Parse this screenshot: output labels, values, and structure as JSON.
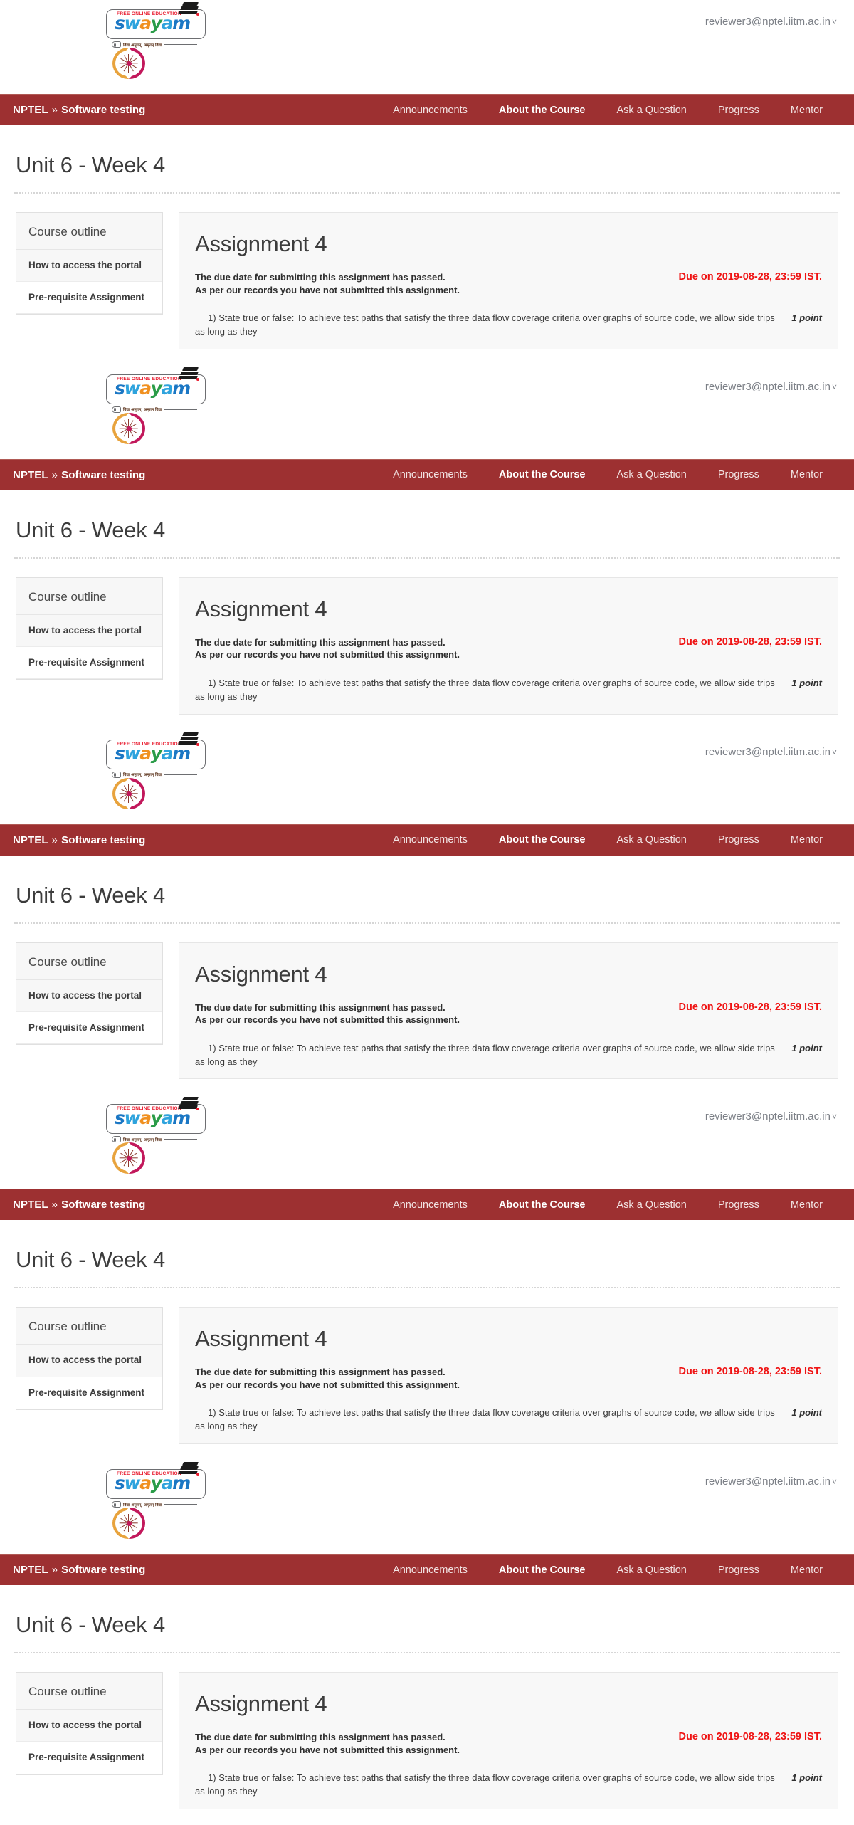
{
  "header": {
    "logo_swayam": {
      "tagline_top": "FREE ONLINE EDUCATION",
      "wordmark": "swayam",
      "tagline_bottom": "विद्या अमृतम्, अमृतम् विद्या"
    },
    "logo_iitm_name": "iitm-logo",
    "user_email": "reviewer3@nptel.iitm.ac.in",
    "user_caret": "˅"
  },
  "navbar": {
    "brand": "NPTEL",
    "separator": "»",
    "course": "Software testing",
    "items": [
      {
        "label": "Announcements",
        "active": false
      },
      {
        "label": "About the Course",
        "active": true
      },
      {
        "label": "Ask a Question",
        "active": false
      },
      {
        "label": "Progress",
        "active": false
      },
      {
        "label": "Mentor",
        "active": false
      }
    ]
  },
  "page": {
    "title": "Unit 6 - Week 4"
  },
  "sidebar": {
    "heading": "Course outline",
    "items": [
      {
        "label": "How to access the portal"
      },
      {
        "label": "Pre-requisite Assignment"
      }
    ]
  },
  "assignment": {
    "title": "Assignment 4",
    "status_line_1": "The due date for submitting this assignment has passed.",
    "status_line_2": "As per our records you have not submitted this assignment.",
    "due_note": "Due on 2019-08-28, 23:59 IST.",
    "question_number": "1)",
    "question_text": "State true or false: To achieve test paths that satisfy the three data flow coverage criteria over graphs of source code, we allow side trips as long as they",
    "points": "1 point"
  },
  "colors": {
    "nav_bg": "#9d3031",
    "due_red": "#ef1313",
    "card_bg": "#f8f8f8",
    "text_dark": "#3c3c3c"
  },
  "repeat_count": 5
}
